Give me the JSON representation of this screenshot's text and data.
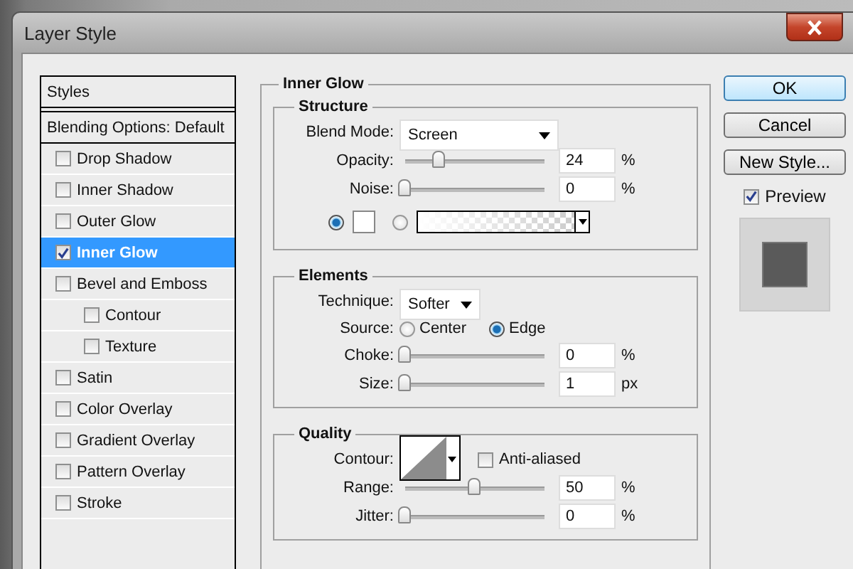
{
  "window": {
    "title": "Layer Style"
  },
  "styles_panel": {
    "header": "Styles",
    "blending": "Blending Options: Default",
    "items": [
      {
        "label": "Drop Shadow",
        "checked": false,
        "selected": false
      },
      {
        "label": "Inner Shadow",
        "checked": false,
        "selected": false
      },
      {
        "label": "Outer Glow",
        "checked": false,
        "selected": false
      },
      {
        "label": "Inner Glow",
        "checked": true,
        "selected": true
      },
      {
        "label": "Bevel and Emboss",
        "checked": false,
        "selected": false,
        "children": [
          {
            "label": "Contour",
            "checked": false,
            "selected": false
          },
          {
            "label": "Texture",
            "checked": false,
            "selected": false
          }
        ]
      },
      {
        "label": "Satin",
        "checked": false,
        "selected": false
      },
      {
        "label": "Color Overlay",
        "checked": false,
        "selected": false
      },
      {
        "label": "Gradient Overlay",
        "checked": false,
        "selected": false
      },
      {
        "label": "Pattern Overlay",
        "checked": false,
        "selected": false
      },
      {
        "label": "Stroke",
        "checked": false,
        "selected": false
      }
    ]
  },
  "inner_glow": {
    "title": "Inner Glow",
    "structure": {
      "title": "Structure",
      "blend_mode": {
        "label": "Blend Mode:",
        "value": "Screen"
      },
      "sliders": [
        {
          "label": "Opacity:",
          "level": 0.24,
          "value": "24",
          "unit": "%"
        },
        {
          "label": "Noise:",
          "level": 0,
          "value": "0",
          "unit": "%"
        }
      ],
      "fill": [
        {
          "kind": "color",
          "selected": true
        },
        {
          "kind": "gradient",
          "selected": false
        }
      ]
    },
    "elements": {
      "title": "Elements",
      "technique": {
        "label": "Technique:",
        "value": "Softer"
      },
      "source": {
        "label": "Source:",
        "options": [
          {
            "label": "Center",
            "selected": false
          },
          {
            "label": "Edge",
            "selected": true
          }
        ]
      },
      "sliders": [
        {
          "label": "Choke:",
          "level": 0,
          "value": "0",
          "unit": "%"
        },
        {
          "label": "Size:",
          "level": 0,
          "value": "1",
          "unit": "px"
        }
      ]
    },
    "quality": {
      "title": "Quality",
      "contour": {
        "label": "Contour:"
      },
      "anti_aliased": {
        "label": "Anti-aliased",
        "checked": false
      },
      "sliders": [
        {
          "label": "Range:",
          "level": 0.5,
          "value": "50",
          "unit": "%"
        },
        {
          "label": "Jitter:",
          "level": 0,
          "value": "0",
          "unit": "%"
        }
      ]
    }
  },
  "buttons": [
    {
      "label": "OK",
      "default": true
    },
    {
      "label": "Cancel",
      "default": false
    },
    {
      "label": "New Style...",
      "default": false
    }
  ],
  "preview": {
    "label": "Preview",
    "checked": true
  }
}
